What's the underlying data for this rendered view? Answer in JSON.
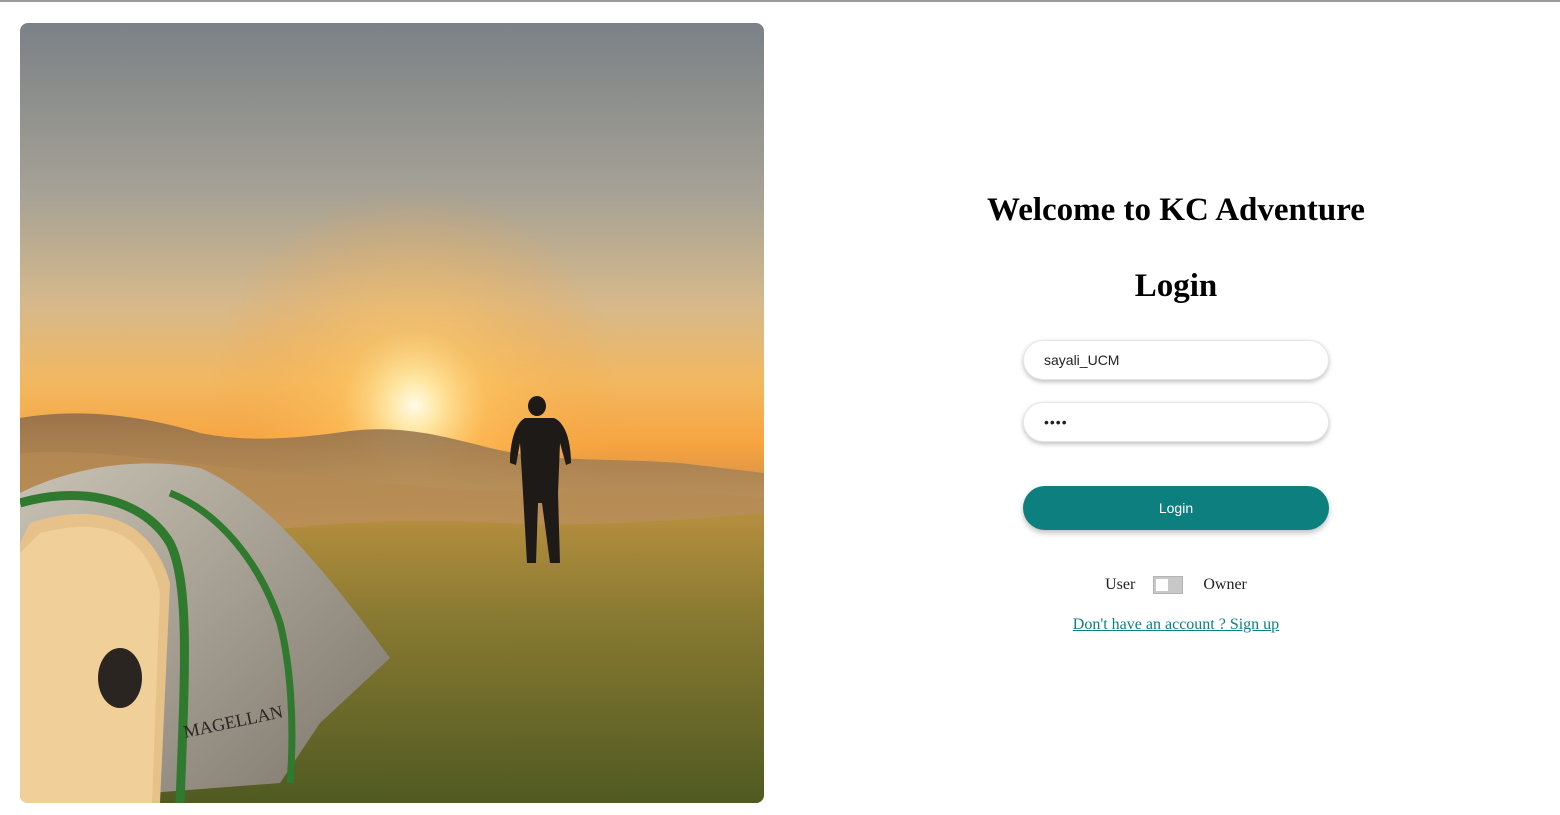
{
  "hero": {
    "image_name": "camping-sunset-photo",
    "tent_logo": "MAGELLAN"
  },
  "login": {
    "welcome_title": "Welcome to KC Adventure",
    "heading": "Login",
    "username_value": "sayali_UCM",
    "password_value": "••••",
    "login_button_label": "Login",
    "role_toggle": {
      "left_label": "User",
      "right_label": "Owner",
      "selected": "User"
    },
    "signup_link_text": "Don't have an account ? Sign up"
  },
  "colors": {
    "accent": "#0d7f7e",
    "toggle_track": "#c8c8c8"
  }
}
